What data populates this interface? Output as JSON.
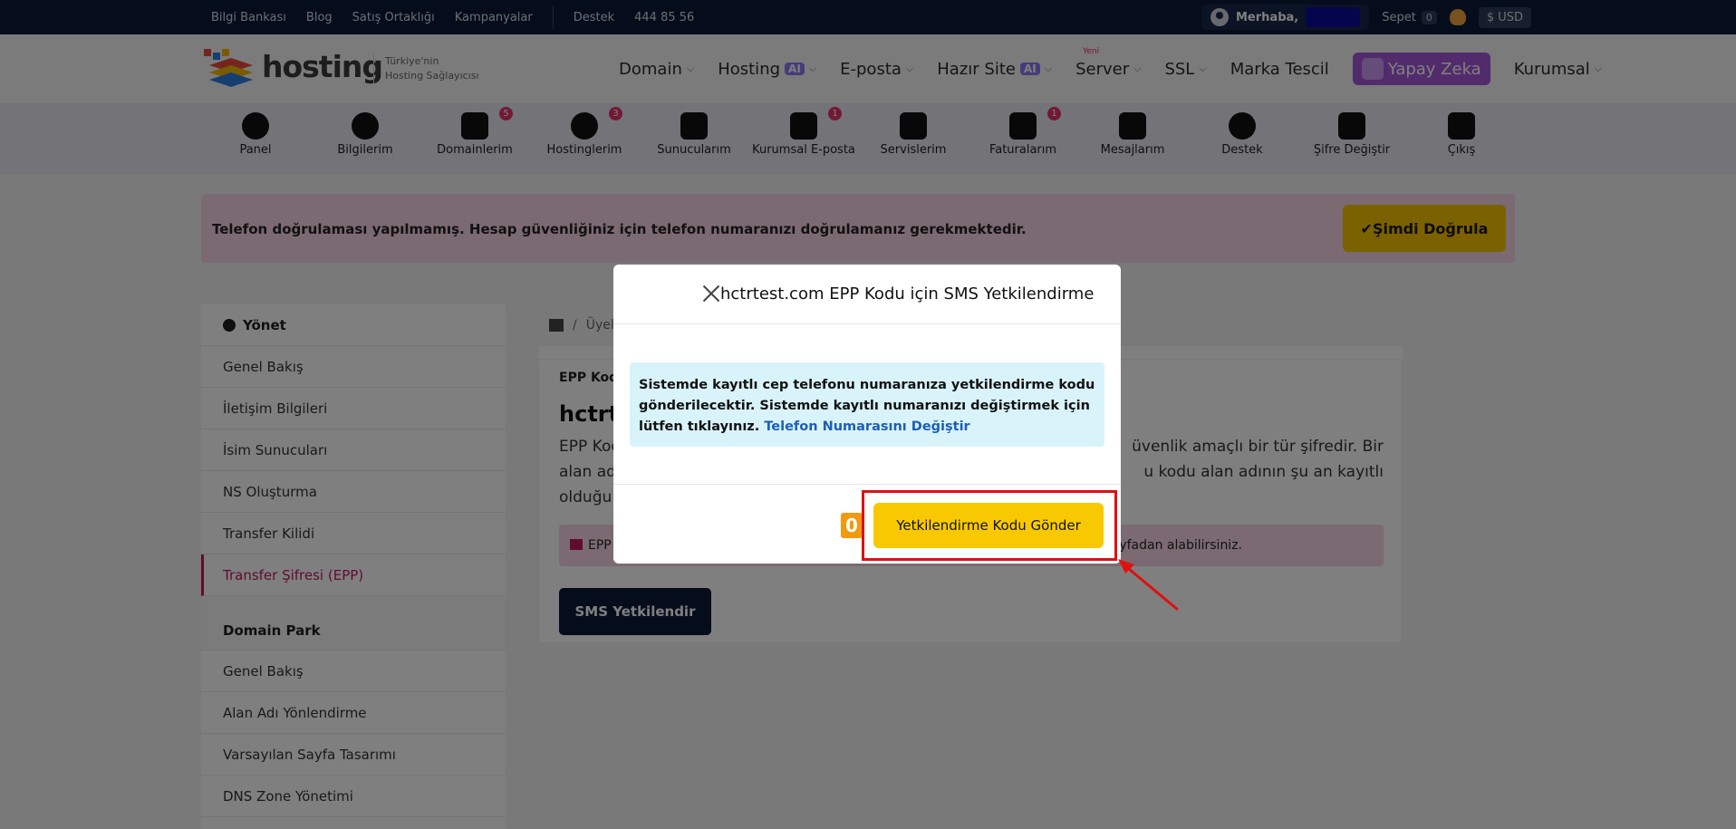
{
  "topbar": {
    "links": [
      "Bilgi Bankası",
      "Blog",
      "Satış Ortaklığı",
      "Kampanyalar"
    ],
    "support": "Destek",
    "phone": "444 85 56",
    "greeting": "Merhaba,",
    "cart_label": "Sepet",
    "cart_count": "0",
    "currency": "$ USD"
  },
  "header": {
    "logo_text": "hosting",
    "tagline_line1": "Türkiye'nin",
    "tagline_line2": "Hosting Sağlayıcısı",
    "nav": [
      {
        "label": "Domain",
        "ai": ""
      },
      {
        "label": "Hosting",
        "ai": "AI"
      },
      {
        "label": "E-posta",
        "ai": ""
      },
      {
        "label": "Hazır Site",
        "ai": "AI"
      },
      {
        "label": "Server",
        "ai": "",
        "new": "Yeni"
      },
      {
        "label": "SSL",
        "ai": ""
      },
      {
        "label": "Marka Tescil",
        "ai": ""
      }
    ],
    "ai_button": "Yapay Zeka",
    "corporate": "Kurumsal"
  },
  "iconbar": {
    "items": [
      {
        "label": "Panel",
        "badge": ""
      },
      {
        "label": "Bilgilerim",
        "badge": ""
      },
      {
        "label": "Domainlerim",
        "badge": "5"
      },
      {
        "label": "Hostinglerim",
        "badge": "3"
      },
      {
        "label": "Sunucularım",
        "badge": ""
      },
      {
        "label": "Kurumsal E-posta",
        "badge": "1"
      },
      {
        "label": "Servislerim",
        "badge": ""
      },
      {
        "label": "Faturalarım",
        "badge": "1"
      },
      {
        "label": "Mesajlarım",
        "badge": ""
      },
      {
        "label": "Destek",
        "badge": ""
      },
      {
        "label": "Şifre Değiştir",
        "badge": ""
      },
      {
        "label": "Çıkış",
        "badge": ""
      }
    ]
  },
  "alert": {
    "text": "Telefon doğrulaması yapılmamış. Hesap güvenliğiniz için telefon numaranızı doğrulamanız gerekmektedir.",
    "button": "✔Şimdi Doğrula"
  },
  "sidebar": {
    "section1": "Yönet",
    "items1": [
      "Genel Bakış",
      "İletişim Bilgileri",
      "İsim Sunucuları",
      "NS Oluşturma",
      "Transfer Kilidi",
      "Transfer Şifresi (EPP)"
    ],
    "section2": "Domain Park",
    "items2": [
      "Genel Bakış",
      "Alan Adı Yönlendirme",
      "Varsayılan Sayfa Tasarımı",
      "DNS Zone Yönetimi"
    ]
  },
  "content": {
    "breadcrumb_sep": "/",
    "breadcrumb_item": "Üyeli",
    "card_title": "EPP Kod",
    "domain": "hctrt",
    "text_left1": "EPP Kod",
    "text_left2": "alan adı",
    "text_left3": "olduğu",
    "text_right1": "üvenlik amaçlı bir tür şifredir. Bir",
    "text_right2": "u kodu alan adının şu an kayıtlı",
    "note_left": "EPP",
    "note_right": "yfadan alabilirsiniz.",
    "sms_button": "SMS Yetkilendir"
  },
  "modal": {
    "title": "hctrtest.com EPP Kodu için SMS Yetkilendirme",
    "info_text": "Sistemde kayıtlı cep telefonu numaranıza yetkilendirme kodu gönderilecektir. Sistemde kayıtlı numaranızı değiştirmek için lütfen tıklayınız.",
    "info_link": "Telefon Numarasını Değiştir",
    "counter": "0",
    "send_button": "Yetkilendirme Kodu Gönder"
  },
  "colors": {
    "topbar": "#0b1a3a",
    "accent_yellow": "#f8c900",
    "accent_pink": "#c2185b",
    "highlight_red": "#e01010"
  }
}
